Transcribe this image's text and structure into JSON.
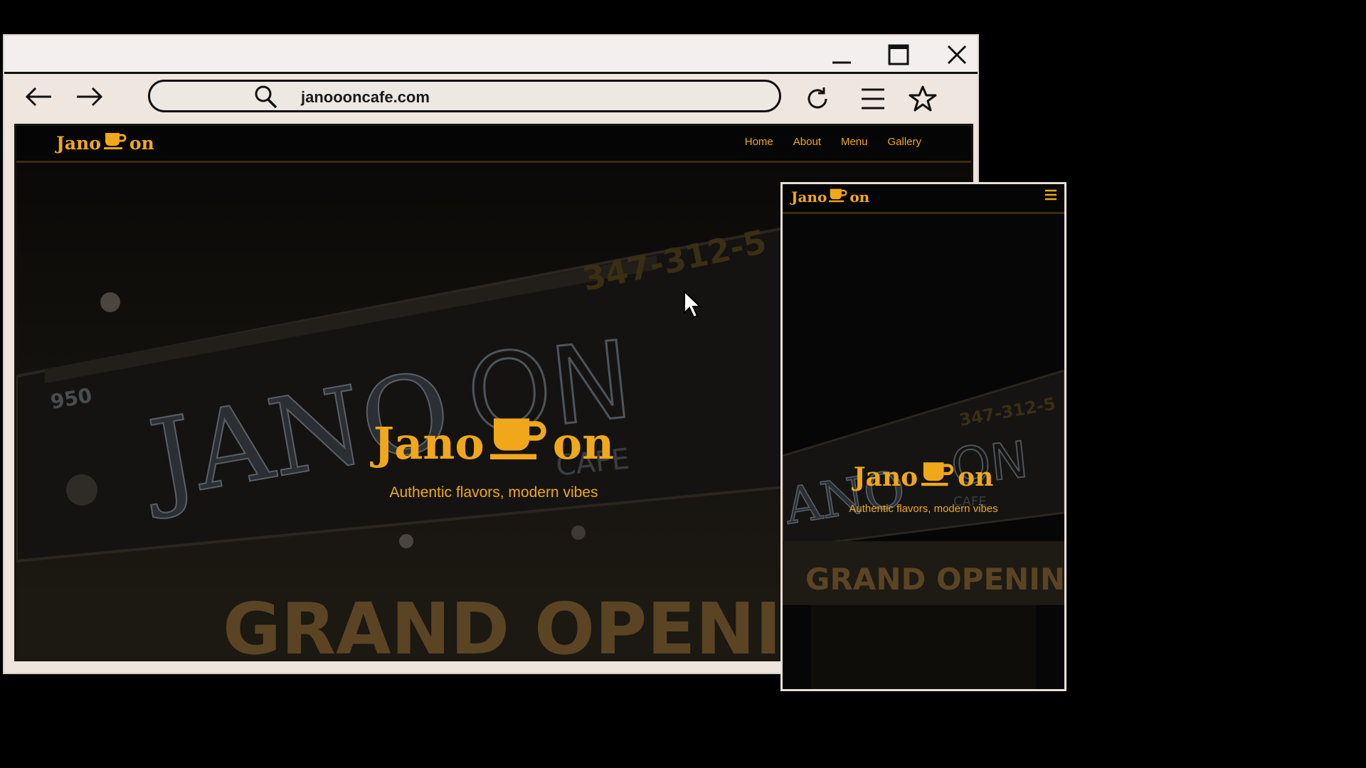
{
  "browser": {
    "url": "janoooncafe.com",
    "window_controls": [
      "minimize-icon",
      "maximize-icon",
      "close-icon"
    ],
    "toolbar_icons": [
      "back-arrow-icon",
      "forward-arrow-icon",
      "search-icon",
      "refresh-icon",
      "menu-icon",
      "star-icon"
    ]
  },
  "site": {
    "logo_left": "Jano",
    "logo_right": "on",
    "logo_icon": "coffee-cup-icon",
    "nav": [
      {
        "label": "Home"
      },
      {
        "label": "About"
      },
      {
        "label": "Menu"
      },
      {
        "label": "Gallery"
      }
    ],
    "hero_title_left": "Jano",
    "hero_title_right": "on",
    "hero_subtitle": "Authentic flavors, modern vibes",
    "background_text": {
      "sign": "JANO",
      "sign_right": "ON",
      "sign_small": "CAFE",
      "phone": "347-312-5",
      "number": "950",
      "banner": "GRAND OPENING"
    }
  },
  "mobile": {
    "logo_left": "Jano",
    "logo_right": "on",
    "menu_icon": "hamburger-icon",
    "hero_title_left": "Jano",
    "hero_title_right": "on",
    "hero_subtitle": "Authentic flavors, modern vibes",
    "background_text": {
      "sign": "JANO",
      "sign_right": "ON",
      "sign_small": "CAFE",
      "phone": "347-312-5",
      "banner": "GRAND OPENING"
    }
  },
  "colors": {
    "brand": "#f0a81a",
    "background": "#000000",
    "browser_chrome": "#efe6df"
  }
}
